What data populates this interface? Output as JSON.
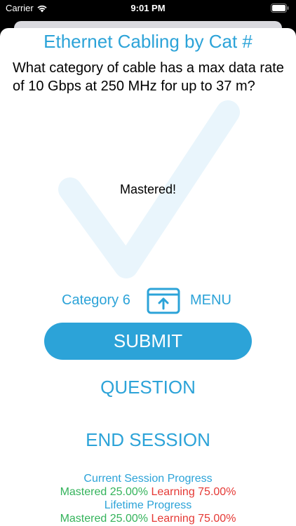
{
  "status": {
    "carrier": "Carrier",
    "time": "9:01 PM"
  },
  "title": "Ethernet Cabling by Cat #",
  "question": "What category of cable has a max data rate of 10 Gbps at 250 MHz for up to 37 m?",
  "feedback": "Mastered!",
  "answer": "Category 6",
  "menu_label": "MENU",
  "buttons": {
    "submit": "SUBMIT",
    "question": "QUESTION",
    "end_session": "END SESSION"
  },
  "progress": {
    "current_heading": "Current Session Progress",
    "current_mastered": "Mastered 25.00%",
    "current_learning": "Learning 75.00%",
    "lifetime_heading": "Lifetime Progress",
    "lifetime_mastered": "Mastered 25.00%",
    "lifetime_learning": "Learning 75.00%"
  },
  "colors": {
    "accent": "#2ca3d8",
    "mastered": "#34b35b",
    "learning": "#e53935"
  },
  "icons": {
    "wifi": "wifi-icon",
    "battery": "battery-icon",
    "menu": "upload-tray-icon",
    "feedback": "checkmark-icon"
  }
}
